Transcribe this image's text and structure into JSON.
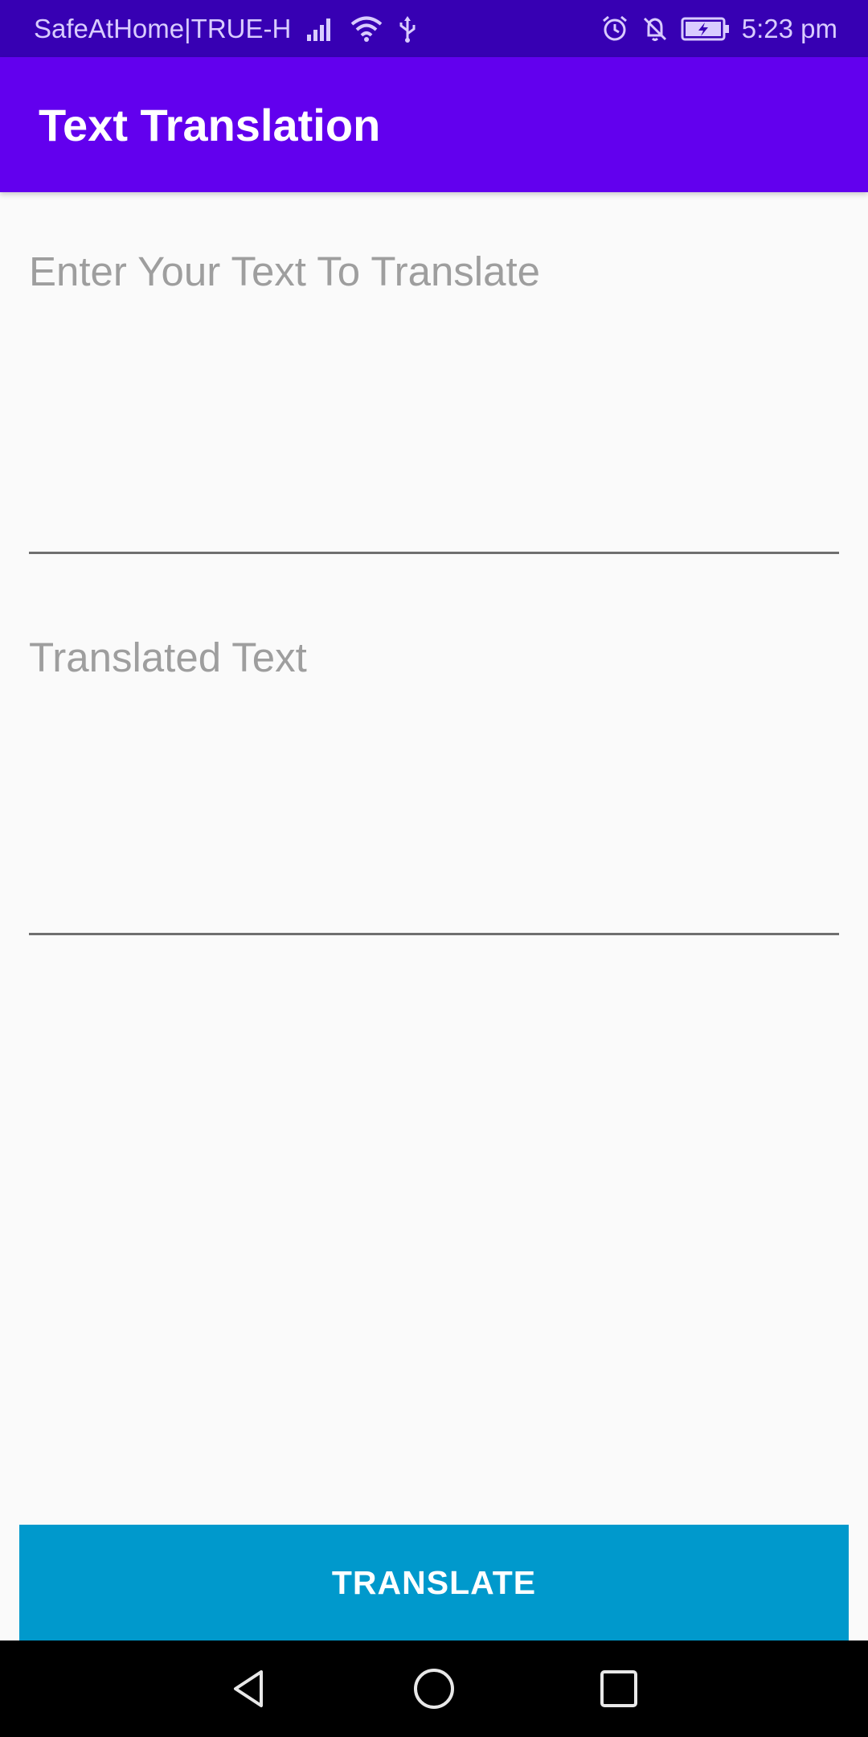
{
  "status_bar": {
    "carrier": "SafeAtHome|TRUE-H",
    "time": "5:23 pm",
    "icons": [
      "signal-icon",
      "wifi-icon",
      "usb-icon",
      "alarm-icon",
      "notifications-off-icon",
      "battery-charging-icon"
    ]
  },
  "app_bar": {
    "title": "Text Translation"
  },
  "source_field": {
    "placeholder": "Enter Your Text To Translate",
    "value": ""
  },
  "target_field": {
    "placeholder": "Translated Text",
    "value": ""
  },
  "translate_button": {
    "label": "TRANSLATE",
    "color": "#0099cc"
  },
  "colors": {
    "status_bar": "#3700b3",
    "app_bar": "#6200ee",
    "background": "#fafafa"
  },
  "nav_bar": {
    "buttons": [
      "back-icon",
      "home-icon",
      "recents-icon"
    ]
  }
}
